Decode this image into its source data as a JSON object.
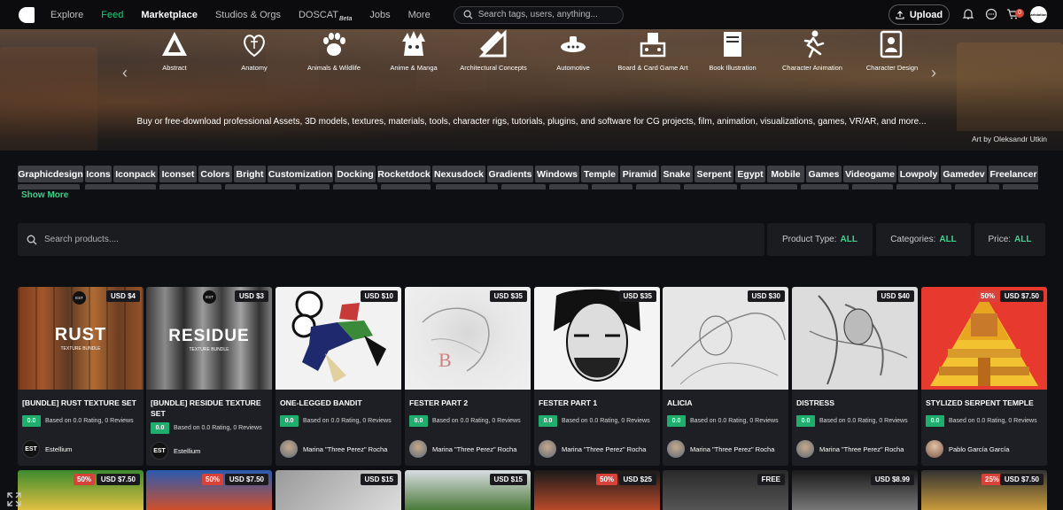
{
  "nav": {
    "links": [
      "Explore",
      "Feed",
      "Marketplace",
      "Studios & Orgs",
      "DOSCAT",
      "Jobs",
      "More"
    ],
    "beta": "Beta",
    "search_placeholder": "Search tags, users, anything...",
    "upload": "Upload",
    "cart_count": "0",
    "avatar_text": "artstation"
  },
  "hero": {
    "categories": [
      "Abstract",
      "Anatomy",
      "Animals & Wildlife",
      "Anime & Manga",
      "Architectural Concepts",
      "Automotive",
      "Board & Card Game Art",
      "Book Illustration",
      "Character Animation",
      "Character Design"
    ],
    "description": "Buy or free-download professional Assets, 3D models, textures, materials, tools, character rigs, tutorials, plugins, and software for CG projects, film, animation, visualizations, games, VR/AR, and more...",
    "credit": "Art by Oleksandr Utkin"
  },
  "tags": [
    "Graphicdesign",
    "Icons",
    "Iconpack",
    "Iconset",
    "Colors",
    "Bright",
    "Customization",
    "Docking",
    "Rocketdock",
    "Nexusdock",
    "Gradients",
    "Windows",
    "Temple",
    "Piramid",
    "Snake",
    "Serpent",
    "Egypt",
    "Mobile",
    "Games",
    "Videogame",
    "Lowpoly",
    "Gamedev",
    "Freelancer"
  ],
  "show_more": "Show More",
  "filters": {
    "search_placeholder": "Search products....",
    "product_type": {
      "label": "Product Type:",
      "value": "ALL"
    },
    "categories": {
      "label": "Categories:",
      "value": "ALL"
    },
    "price": {
      "label": "Price:",
      "value": "ALL"
    }
  },
  "products": [
    {
      "title": "[BUNDLE] RUST TEXTURE SET",
      "price": "USD $4",
      "sale": "",
      "rating": "0.0",
      "rating_text": "Based on 0.0 Rating, 0 Reviews",
      "author": "Estellium",
      "img_text": "RUST",
      "img_sub": "TEXTURE BUNDLE",
      "badge": "EST",
      "avatar_text": "EST"
    },
    {
      "title": "[BUNDLE] RESIDUE TEXTURE SET",
      "price": "USD $3",
      "sale": "",
      "rating": "0.0",
      "rating_text": "Based on 0.0 Rating, 0 Reviews",
      "author": "Estellium",
      "img_text": "RESIDUE",
      "img_sub": "TEXTURE BUNDLE",
      "badge": "EST",
      "avatar_text": "EST"
    },
    {
      "title": "ONE-LEGGED BANDIT",
      "price": "USD $10",
      "sale": "",
      "rating": "0.0",
      "rating_text": "Based on 0.0 Rating, 0 Reviews",
      "author": "Marina \"Three Perez\" Rocha"
    },
    {
      "title": "FESTER PART 2",
      "price": "USD $35",
      "sale": "",
      "rating": "0.0",
      "rating_text": "Based on 0.0 Rating, 0 Reviews",
      "author": "Marina \"Three Perez\" Rocha"
    },
    {
      "title": "FESTER PART 1",
      "price": "USD $35",
      "sale": "",
      "rating": "0.0",
      "rating_text": "Based on 0.0 Rating, 0 Reviews",
      "author": "Marina \"Three Perez\" Rocha"
    },
    {
      "title": "ALICIA",
      "price": "USD $30",
      "sale": "",
      "rating": "0.0",
      "rating_text": "Based on 0.0 Rating, 0 Reviews",
      "author": "Marina \"Three Perez\" Rocha"
    },
    {
      "title": "DISTRESS",
      "price": "USD $40",
      "sale": "",
      "rating": "0.0",
      "rating_text": "Based on 0.0 Rating, 0 Reviews",
      "author": "Marina \"Three Perez\" Rocha"
    },
    {
      "title": "STYLIZED SERPENT TEMPLE",
      "price": "USD $7.50",
      "sale": "50%",
      "rating": "0.0",
      "rating_text": "Based on 0.0 Rating, 0 Reviews",
      "author": "Pablo García García"
    }
  ],
  "products_row2": [
    {
      "price": "USD $7.50",
      "sale": "50%"
    },
    {
      "price": "USD $7.50",
      "sale": "50%"
    },
    {
      "price": "USD $15",
      "sale": ""
    },
    {
      "price": "USD $15",
      "sale": ""
    },
    {
      "price": "USD $25",
      "sale": "50%"
    },
    {
      "price": "FREE",
      "sale": ""
    },
    {
      "price": "USD $8.99",
      "sale": ""
    },
    {
      "price": "USD $7.50",
      "sale": "25%"
    }
  ],
  "colors": {
    "accent": "#1ecb7d",
    "sale": "#d7433a",
    "rating": "#1fae6d"
  }
}
